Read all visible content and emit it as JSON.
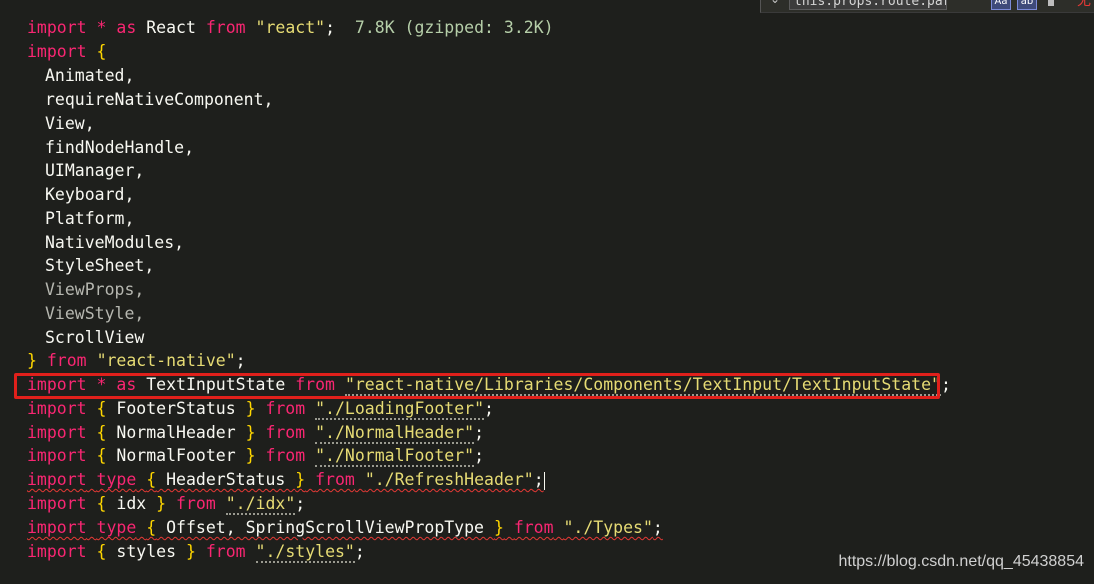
{
  "find_widget": {
    "search_value": "this.props.route.params.iter",
    "case_toggle": "Aa",
    "word_toggle": "ab",
    "red_glyph": "无"
  },
  "code": {
    "l1": {
      "kw1": "import",
      "star": " * ",
      "as": "as",
      "name": " React ",
      "from": "from",
      "sp": " ",
      "str": "\"react\"",
      "semi": ";",
      "hint": "7.8K (gzipped: 3.2K)"
    },
    "l2": {
      "kw": "import",
      "brace": "{"
    },
    "members": [
      "Animated,",
      "requireNativeComponent,",
      "View,",
      "findNodeHandle,",
      "UIManager,",
      "Keyboard,",
      "Platform,",
      "NativeModules,",
      "StyleSheet,",
      "ViewProps,",
      "ViewStyle,",
      "ScrollView"
    ],
    "l15": {
      "brace": "}",
      "from": "from",
      "str": "\"react-native\"",
      "semi": ";"
    },
    "l16": {
      "kw": "import",
      "star": " * ",
      "as": "as",
      "name": " TextInputState ",
      "from": "from",
      "str": "\"react-native/Libraries/Components/TextInput/TextInputState\"",
      "semi": ";"
    },
    "l17": {
      "kw": "import",
      "lb": "{",
      "name": " FooterStatus ",
      "rb": "}",
      "from": "from",
      "str": "\"./LoadingFooter\"",
      "semi": ";"
    },
    "l18": {
      "kw": "import",
      "lb": "{",
      "name": " NormalHeader ",
      "rb": "}",
      "from": "from",
      "str": "\"./NormalHeader\"",
      "semi": ";"
    },
    "l19": {
      "kw": "import",
      "lb": "{",
      "name": " NormalFooter ",
      "rb": "}",
      "from": "from",
      "str": "\"./NormalFooter\"",
      "semi": ";"
    },
    "l20": {
      "kw": "import",
      "type": "type",
      "lb": "{",
      "name": " HeaderStatus ",
      "rb": "}",
      "from": "from",
      "str": "\"./RefreshHeader\"",
      "semi": ";"
    },
    "l21": {
      "kw": "import",
      "lb": "{",
      "name": " idx ",
      "rb": "}",
      "from": "from",
      "str": "\"./idx\"",
      "semi": ";"
    },
    "l22": {
      "kw": "import",
      "type": "type",
      "lb": "{",
      "name": " Offset, SpringScrollViewPropType ",
      "rb": "}",
      "from": "from",
      "str": "\"./Types\"",
      "semi": ";"
    },
    "l23": {
      "kw": "import",
      "lb": "{",
      "name": " styles ",
      "rb": "}",
      "from": "from",
      "str": "\"./styles\"",
      "semi": ";"
    }
  },
  "watermark": "https://blog.csdn.net/qq_45438854",
  "colors": {
    "background": "#1e1f1c",
    "keyword": "#f92672",
    "string": "#e6db74",
    "bracket": "#ffd700",
    "highlight_border": "#e0201b"
  }
}
